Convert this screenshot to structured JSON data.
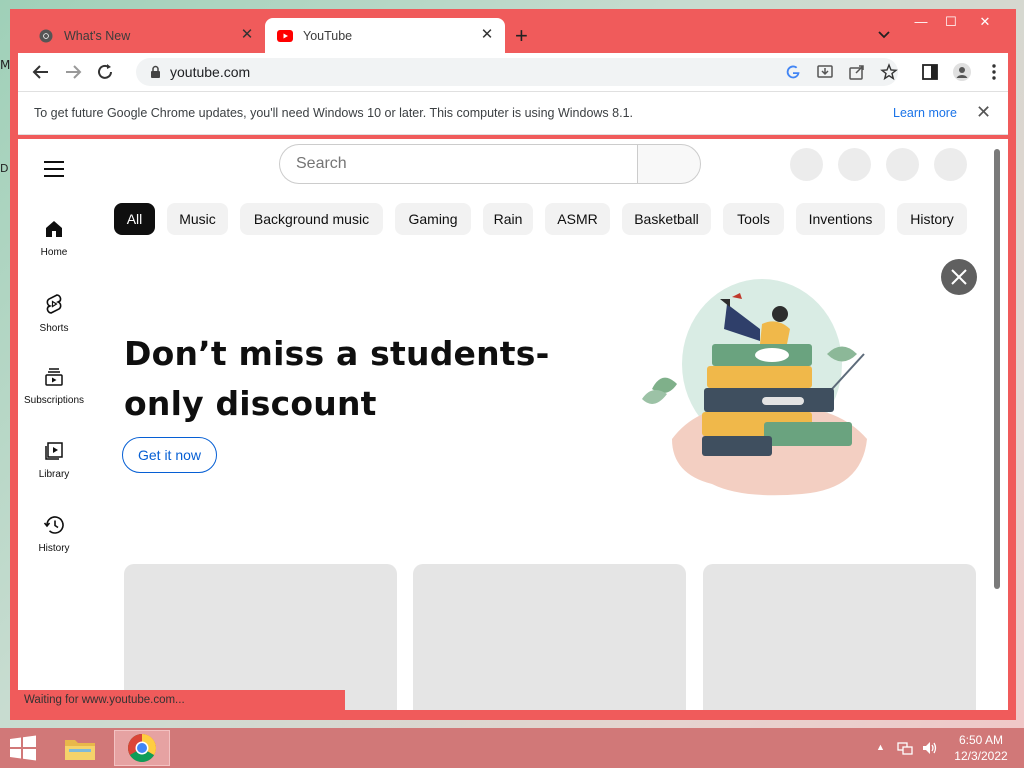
{
  "desktop": {
    "icon_m": "M",
    "icon_d": "D"
  },
  "browser": {
    "tabs": [
      {
        "title": "What's New",
        "icon": "chrome-icon"
      },
      {
        "title": "YouTube",
        "icon": "youtube-icon"
      }
    ],
    "address": "youtube.com",
    "infobar": {
      "message": "To get future Google Chrome updates, you'll need Windows 10 or later. This computer is using Windows 8.1.",
      "link": "Learn more"
    },
    "status_text": "Waiting for www.youtube.com...",
    "accent_color": "#f05b5b"
  },
  "youtube": {
    "search_placeholder": "Search",
    "sidebar": [
      {
        "label": "Home",
        "icon": "home-icon"
      },
      {
        "label": "Shorts",
        "icon": "shorts-icon"
      },
      {
        "label": "Subscriptions",
        "icon": "subscriptions-icon"
      },
      {
        "label": "Library",
        "icon": "library-icon"
      },
      {
        "label": "History",
        "icon": "history-icon"
      }
    ],
    "chips": [
      "All",
      "Music",
      "Background music",
      "Gaming",
      "Rain",
      "ASMR",
      "Basketball",
      "Tools",
      "Inventions",
      "History"
    ],
    "promo": {
      "title": "Don’t miss a students-only discount",
      "button": "Get it now"
    }
  },
  "taskbar": {
    "time": "6:50 AM",
    "date": "12/3/2022"
  }
}
